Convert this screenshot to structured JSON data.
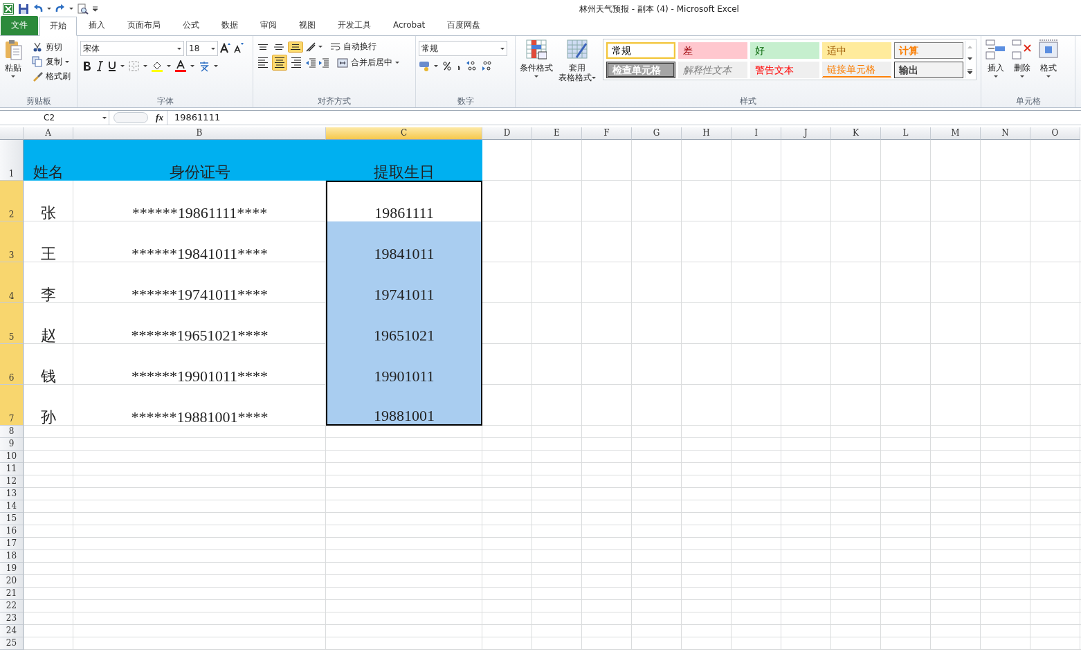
{
  "window": {
    "title": "林州天气预报 - 副本 (4)  -  Microsoft Excel"
  },
  "tabs": [
    {
      "label": "文件",
      "selected": false,
      "kind": "file"
    },
    {
      "label": "开始",
      "selected": true,
      "kind": "tab"
    },
    {
      "label": "插入",
      "selected": false,
      "kind": "tab"
    },
    {
      "label": "页面布局",
      "selected": false,
      "kind": "tab"
    },
    {
      "label": "公式",
      "selected": false,
      "kind": "tab"
    },
    {
      "label": "数据",
      "selected": false,
      "kind": "tab"
    },
    {
      "label": "审阅",
      "selected": false,
      "kind": "tab"
    },
    {
      "label": "视图",
      "selected": false,
      "kind": "tab"
    },
    {
      "label": "开发工具",
      "selected": false,
      "kind": "tab"
    },
    {
      "label": "Acrobat",
      "selected": false,
      "kind": "tab"
    },
    {
      "label": "百度网盘",
      "selected": false,
      "kind": "tab"
    }
  ],
  "ribbon": {
    "clipboard": {
      "label": "剪贴板",
      "paste": "粘贴",
      "commands": [
        "剪切",
        "复制",
        "格式刷"
      ]
    },
    "font": {
      "label": "字体",
      "font_name": "宋体",
      "font_size": "18"
    },
    "alignment": {
      "label": "对齐方式",
      "vertical": [
        {
          "kind": "top",
          "selected": false
        },
        {
          "kind": "middle",
          "selected": false
        },
        {
          "kind": "bottom",
          "selected": true
        }
      ],
      "horizontal": [
        {
          "kind": "left",
          "selected": false
        },
        {
          "kind": "center",
          "selected": true
        },
        {
          "kind": "right",
          "selected": false
        }
      ],
      "wrap": "自动换行",
      "merge": "合并后居中"
    },
    "number": {
      "label": "数字",
      "format": "常规"
    },
    "styles": {
      "label": "样式",
      "conditional": "条件格式",
      "table_format": [
        "套用",
        "表格格式"
      ],
      "gallery": [
        {
          "label": "常规",
          "kind": "normal",
          "selected": true
        },
        {
          "label": "差",
          "kind": "bad",
          "selected": false
        },
        {
          "label": "好",
          "kind": "good",
          "selected": false
        },
        {
          "label": "适中",
          "kind": "neutral",
          "selected": false
        },
        {
          "label": "计算",
          "kind": "calculation",
          "selected": false
        },
        {
          "label": "检查单元格",
          "kind": "check",
          "selected": false
        },
        {
          "label": "解释性文本",
          "kind": "explanatory",
          "selected": false
        },
        {
          "label": "警告文本",
          "kind": "warning",
          "selected": false
        },
        {
          "label": "链接单元格",
          "kind": "linked",
          "selected": false
        },
        {
          "label": "输出",
          "kind": "output",
          "selected": false
        }
      ]
    },
    "cells": {
      "label": "单元格",
      "commands": [
        "插入",
        "删除",
        "格式"
      ]
    }
  },
  "formula_bar": {
    "name_box": "C2",
    "function_label": "fx",
    "formula": "19861111"
  },
  "sheet": {
    "columns": [
      {
        "letter": "A",
        "selected": false
      },
      {
        "letter": "B",
        "selected": false
      },
      {
        "letter": "C",
        "selected": true
      },
      {
        "letter": "D",
        "selected": false
      },
      {
        "letter": "E",
        "selected": false
      },
      {
        "letter": "F",
        "selected": false
      },
      {
        "letter": "G",
        "selected": false
      },
      {
        "letter": "H",
        "selected": false
      },
      {
        "letter": "I",
        "selected": false
      },
      {
        "letter": "J",
        "selected": false
      },
      {
        "letter": "K",
        "selected": false
      },
      {
        "letter": "L",
        "selected": false
      },
      {
        "letter": "M",
        "selected": false
      },
      {
        "letter": "N",
        "selected": false
      },
      {
        "letter": "O",
        "selected": false
      }
    ],
    "rows": [
      {
        "number": "1",
        "selected": false,
        "kind": "header",
        "cells": [
          {
            "text": "姓名",
            "selected": false,
            "active": false
          },
          {
            "text": "身份证号",
            "selected": false,
            "active": false
          },
          {
            "text": "提取生日",
            "selected": false,
            "active": false
          }
        ]
      },
      {
        "number": "2",
        "selected": true,
        "kind": "data",
        "cells": [
          {
            "text": "张",
            "selected": false,
            "active": false
          },
          {
            "text": "******19861111****",
            "selected": false,
            "active": false
          },
          {
            "text": "19861111",
            "selected": true,
            "active": true
          }
        ]
      },
      {
        "number": "3",
        "selected": true,
        "kind": "data",
        "cells": [
          {
            "text": "王",
            "selected": false,
            "active": false
          },
          {
            "text": "******19841011****",
            "selected": false,
            "active": false
          },
          {
            "text": "19841011",
            "selected": true,
            "active": false
          }
        ]
      },
      {
        "number": "4",
        "selected": true,
        "kind": "data",
        "cells": [
          {
            "text": "李",
            "selected": false,
            "active": false
          },
          {
            "text": "******19741011****",
            "selected": false,
            "active": false
          },
          {
            "text": "19741011",
            "selected": true,
            "active": false
          }
        ]
      },
      {
        "number": "5",
        "selected": true,
        "kind": "data",
        "cells": [
          {
            "text": "赵",
            "selected": false,
            "active": false
          },
          {
            "text": "******19651021****",
            "selected": false,
            "active": false
          },
          {
            "text": "19651021",
            "selected": true,
            "active": false
          }
        ]
      },
      {
        "number": "6",
        "selected": true,
        "kind": "data",
        "cells": [
          {
            "text": "钱",
            "selected": false,
            "active": false
          },
          {
            "text": "******19901011****",
            "selected": false,
            "active": false
          },
          {
            "text": "19901011",
            "selected": true,
            "active": false
          }
        ]
      },
      {
        "number": "7",
        "selected": true,
        "kind": "data",
        "cells": [
          {
            "text": "孙",
            "selected": false,
            "active": false
          },
          {
            "text": "******19881001****",
            "selected": false,
            "active": false
          },
          {
            "text": "19881001",
            "selected": true,
            "active": false
          }
        ]
      },
      {
        "number": "8",
        "selected": false,
        "kind": "empty"
      },
      {
        "number": "9",
        "selected": false,
        "kind": "empty"
      },
      {
        "number": "10",
        "selected": false,
        "kind": "empty"
      },
      {
        "number": "11",
        "selected": false,
        "kind": "empty"
      },
      {
        "number": "12",
        "selected": false,
        "kind": "empty"
      },
      {
        "number": "13",
        "selected": false,
        "kind": "empty"
      },
      {
        "number": "14",
        "selected": false,
        "kind": "empty"
      },
      {
        "number": "15",
        "selected": false,
        "kind": "empty"
      },
      {
        "number": "16",
        "selected": false,
        "kind": "empty"
      },
      {
        "number": "17",
        "selected": false,
        "kind": "empty"
      },
      {
        "number": "18",
        "selected": false,
        "kind": "empty"
      },
      {
        "number": "19",
        "selected": false,
        "kind": "empty"
      },
      {
        "number": "20",
        "selected": false,
        "kind": "empty"
      },
      {
        "number": "21",
        "selected": false,
        "kind": "empty"
      },
      {
        "number": "22",
        "selected": false,
        "kind": "empty"
      },
      {
        "number": "23",
        "selected": false,
        "kind": "empty"
      },
      {
        "number": "24",
        "selected": false,
        "kind": "empty"
      },
      {
        "number": "25",
        "selected": false,
        "kind": "empty"
      }
    ]
  }
}
